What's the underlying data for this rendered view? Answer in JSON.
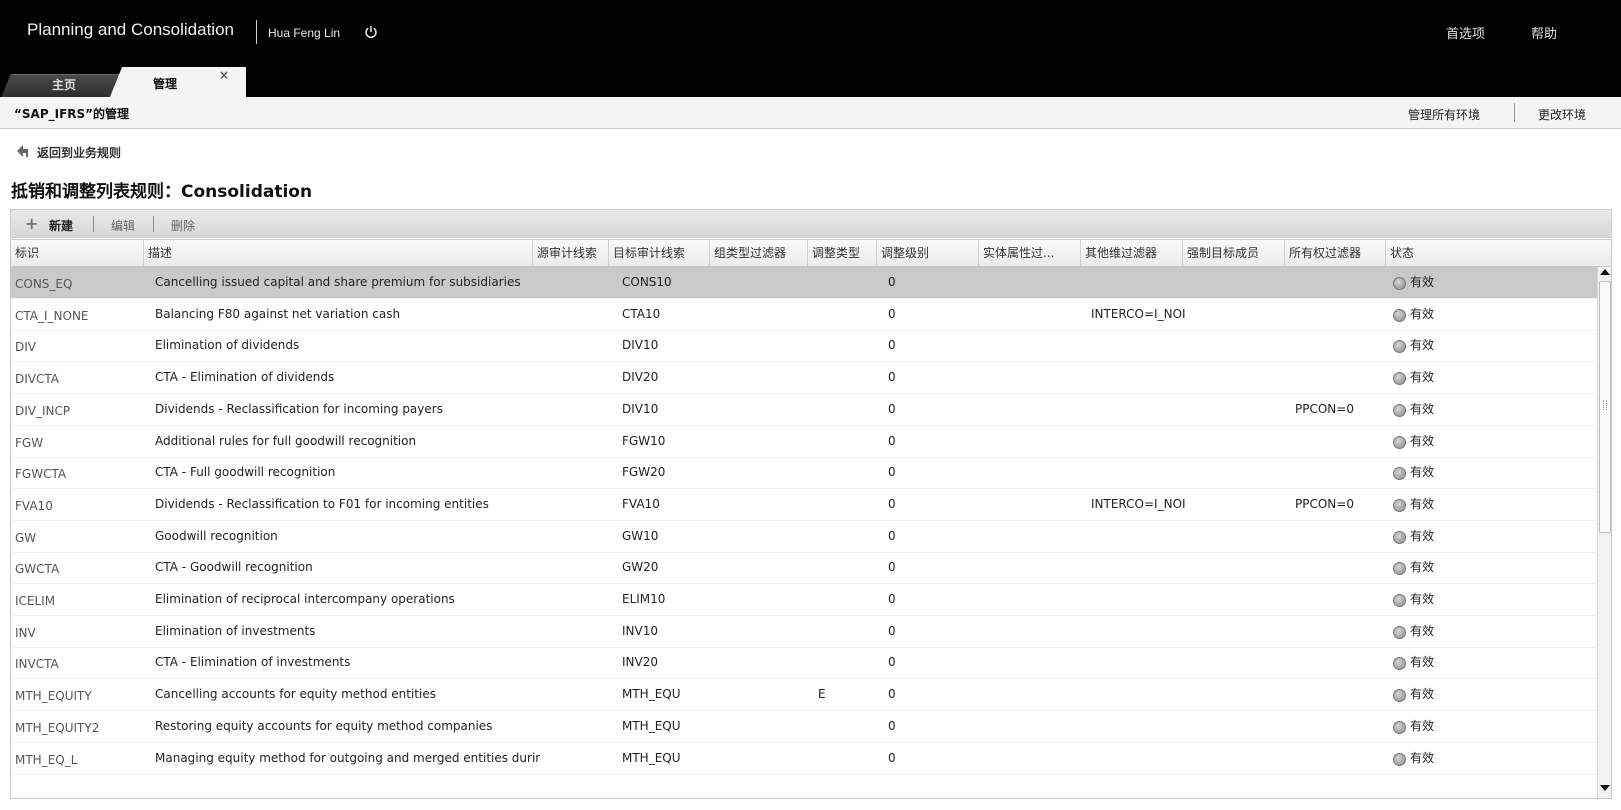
{
  "header": {
    "app_title": "Planning and Consolidation",
    "user_name": "Hua Feng Lin",
    "power_icon": "power-icon",
    "preferences_label": "首选项",
    "help_label": "帮助"
  },
  "tabs": [
    {
      "label": "主页",
      "active": false
    },
    {
      "label": "管理",
      "active": true,
      "close_glyph": "×"
    }
  ],
  "subheader": {
    "env_title": "“SAP_IFRS”的管理",
    "manage_all_label": "管理所有环境",
    "change_env_label": "更改环境"
  },
  "back_link": {
    "label": "返回到业务规则",
    "icon": "back-arrow-icon"
  },
  "page_title": "抵销和调整列表规则：Consolidation",
  "toolbar": {
    "new_label": "新建",
    "new_icon": "plus-icon",
    "edit_label": "编辑",
    "delete_label": "删除"
  },
  "table": {
    "columns": [
      "标识",
      "描述",
      "源审计线索",
      "目标审计线索",
      "组类型过滤器",
      "调整类型",
      "调整级别",
      "实体属性过...",
      "其他维过滤器",
      "强制目标成员",
      "所有权过滤器",
      "状态"
    ],
    "rows": [
      {
        "id": "CONS_EQ",
        "desc": "Cancelling issued capital and share premium for subsidiaries",
        "target": "CONS10",
        "adj_type": "",
        "level": "0",
        "other": "",
        "owner": "",
        "status": "有效",
        "selected": true
      },
      {
        "id": "CTA_I_NONE",
        "desc": "Balancing F80 against net variation cash",
        "target": "CTA10",
        "adj_type": "",
        "level": "0",
        "other": "INTERCO=I_NOI",
        "owner": "",
        "status": "有效"
      },
      {
        "id": "DIV",
        "desc": "Elimination of dividends",
        "target": "DIV10",
        "adj_type": "",
        "level": "0",
        "other": "",
        "owner": "",
        "status": "有效"
      },
      {
        "id": "DIVCTA",
        "desc": "CTA - Elimination of dividends",
        "target": "DIV20",
        "adj_type": "",
        "level": "0",
        "other": "",
        "owner": "",
        "status": "有效"
      },
      {
        "id": "DIV_INCP",
        "desc": "Dividends - Reclassification for incoming payers",
        "target": "DIV10",
        "adj_type": "",
        "level": "0",
        "other": "",
        "owner": "PPCON=0",
        "status": "有效"
      },
      {
        "id": "FGW",
        "desc": "Additional rules for full goodwill recognition",
        "target": "FGW10",
        "adj_type": "",
        "level": "0",
        "other": "",
        "owner": "",
        "status": "有效"
      },
      {
        "id": "FGWCTA",
        "desc": "CTA - Full goodwill recognition",
        "target": "FGW20",
        "adj_type": "",
        "level": "0",
        "other": "",
        "owner": "",
        "status": "有效"
      },
      {
        "id": "FVA10",
        "desc": "Dividends - Reclassification to F01 for incoming entities",
        "target": "FVA10",
        "adj_type": "",
        "level": "0",
        "other": "INTERCO=I_NOI",
        "owner": "PPCON=0",
        "status": "有效"
      },
      {
        "id": "GW",
        "desc": "Goodwill recognition",
        "target": "GW10",
        "adj_type": "",
        "level": "0",
        "other": "",
        "owner": "",
        "status": "有效"
      },
      {
        "id": "GWCTA",
        "desc": "CTA - Goodwill recognition",
        "target": "GW20",
        "adj_type": "",
        "level": "0",
        "other": "",
        "owner": "",
        "status": "有效"
      },
      {
        "id": "ICELIM",
        "desc": "Elimination of reciprocal intercompany operations",
        "target": "ELIM10",
        "adj_type": "",
        "level": "0",
        "other": "",
        "owner": "",
        "status": "有效"
      },
      {
        "id": "INV",
        "desc": "Elimination of investments",
        "target": "INV10",
        "adj_type": "",
        "level": "0",
        "other": "",
        "owner": "",
        "status": "有效"
      },
      {
        "id": "INVCTA",
        "desc": "CTA - Elimination of investments",
        "target": "INV20",
        "adj_type": "",
        "level": "0",
        "other": "",
        "owner": "",
        "status": "有效"
      },
      {
        "id": "MTH_EQUITY",
        "desc": "Cancelling accounts for equity method entities",
        "target": "MTH_EQU",
        "adj_type": "E",
        "level": "0",
        "other": "",
        "owner": "",
        "status": "有效"
      },
      {
        "id": "MTH_EQUITY2",
        "desc": "Restoring equity accounts for equity method companies",
        "target": "MTH_EQU",
        "adj_type": "",
        "level": "0",
        "other": "",
        "owner": "",
        "status": "有效"
      },
      {
        "id": "MTH_EQ_L",
        "desc": "Managing equity method for outgoing and merged entities during",
        "target": "MTH_EQU",
        "adj_type": "",
        "level": "0",
        "other": "",
        "owner": "",
        "status": "有效"
      }
    ]
  },
  "colors": {
    "header_bg": "#000000",
    "selected_row": "#c9c9c9",
    "status_dot": "#9a9a9a"
  }
}
